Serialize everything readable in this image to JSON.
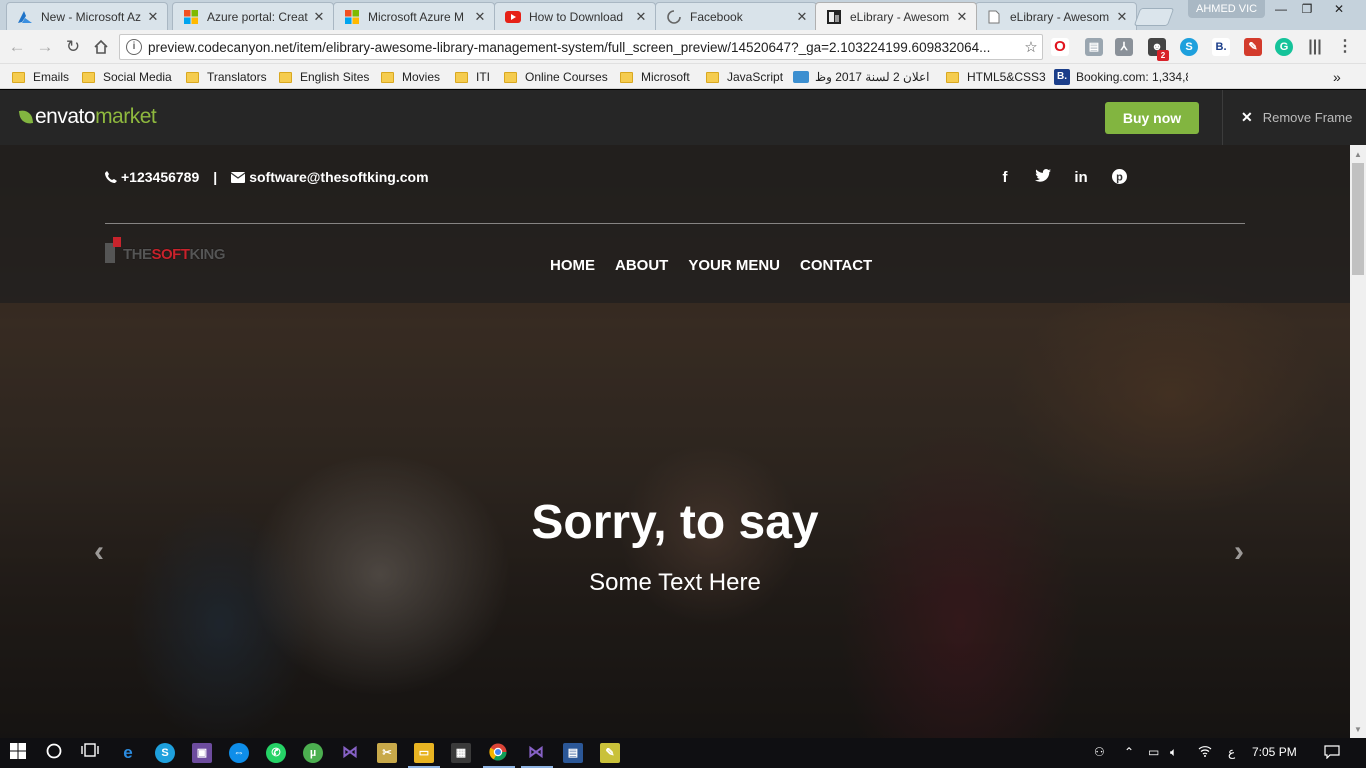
{
  "browser": {
    "tabs": [
      {
        "title": "New - Microsoft Az",
        "icon": "azure-icon"
      },
      {
        "title": "Azure portal: Creat",
        "icon": "microsoft-icon"
      },
      {
        "title": "Microsoft Azure M",
        "icon": "microsoft-icon"
      },
      {
        "title": "How to Download",
        "icon": "youtube-icon"
      },
      {
        "title": "Facebook",
        "icon": "loading-icon"
      },
      {
        "title": "eLibrary - Awesom",
        "icon": "elibrary-icon"
      },
      {
        "title": "eLibrary - Awesom",
        "icon": "page-icon"
      }
    ],
    "active_tab_index": 5,
    "profile_name": "AHMED VIC",
    "url": "preview.codecanyon.net/item/elibrary-awesome-library-management-system/full_screen_preview/14520647?_ga=2.103224199.609832064...",
    "extension_badge": "2",
    "bookmarks": [
      "Emails",
      "Social Media",
      "Translators",
      "English Sites",
      "Movies",
      "ITI",
      "Online Courses",
      "Microsoft",
      "JavaScript",
      "اعلان 2 لسنة 2017 وظ",
      "HTML5&CSS3",
      "Booking.com: 1,334,8"
    ],
    "bookmarks_overflow": "»"
  },
  "envato": {
    "logo_word": "envato",
    "logo_market": "market",
    "buy_label": "Buy now",
    "remove_frame_label": "Remove Frame"
  },
  "site": {
    "phone": "+123456789",
    "separator": "|",
    "email": "software@thesoftking.com",
    "socials": [
      "facebook-icon",
      "twitter-icon",
      "linkedin-icon",
      "pinterest-icon"
    ],
    "logo_text_a": "THE",
    "logo_text_b": "SOFT",
    "logo_text_c": "KING",
    "menu": [
      "HOME",
      "ABOUT",
      "YOUR MENU",
      "CONTACT"
    ],
    "headline": "Sorry, to say",
    "subheadline": "Some Text Here"
  },
  "taskbar": {
    "lang": "ع",
    "time": "7:05 PM"
  },
  "colors": {
    "envato_green": "#82b540",
    "logo_red": "#c8232c"
  }
}
